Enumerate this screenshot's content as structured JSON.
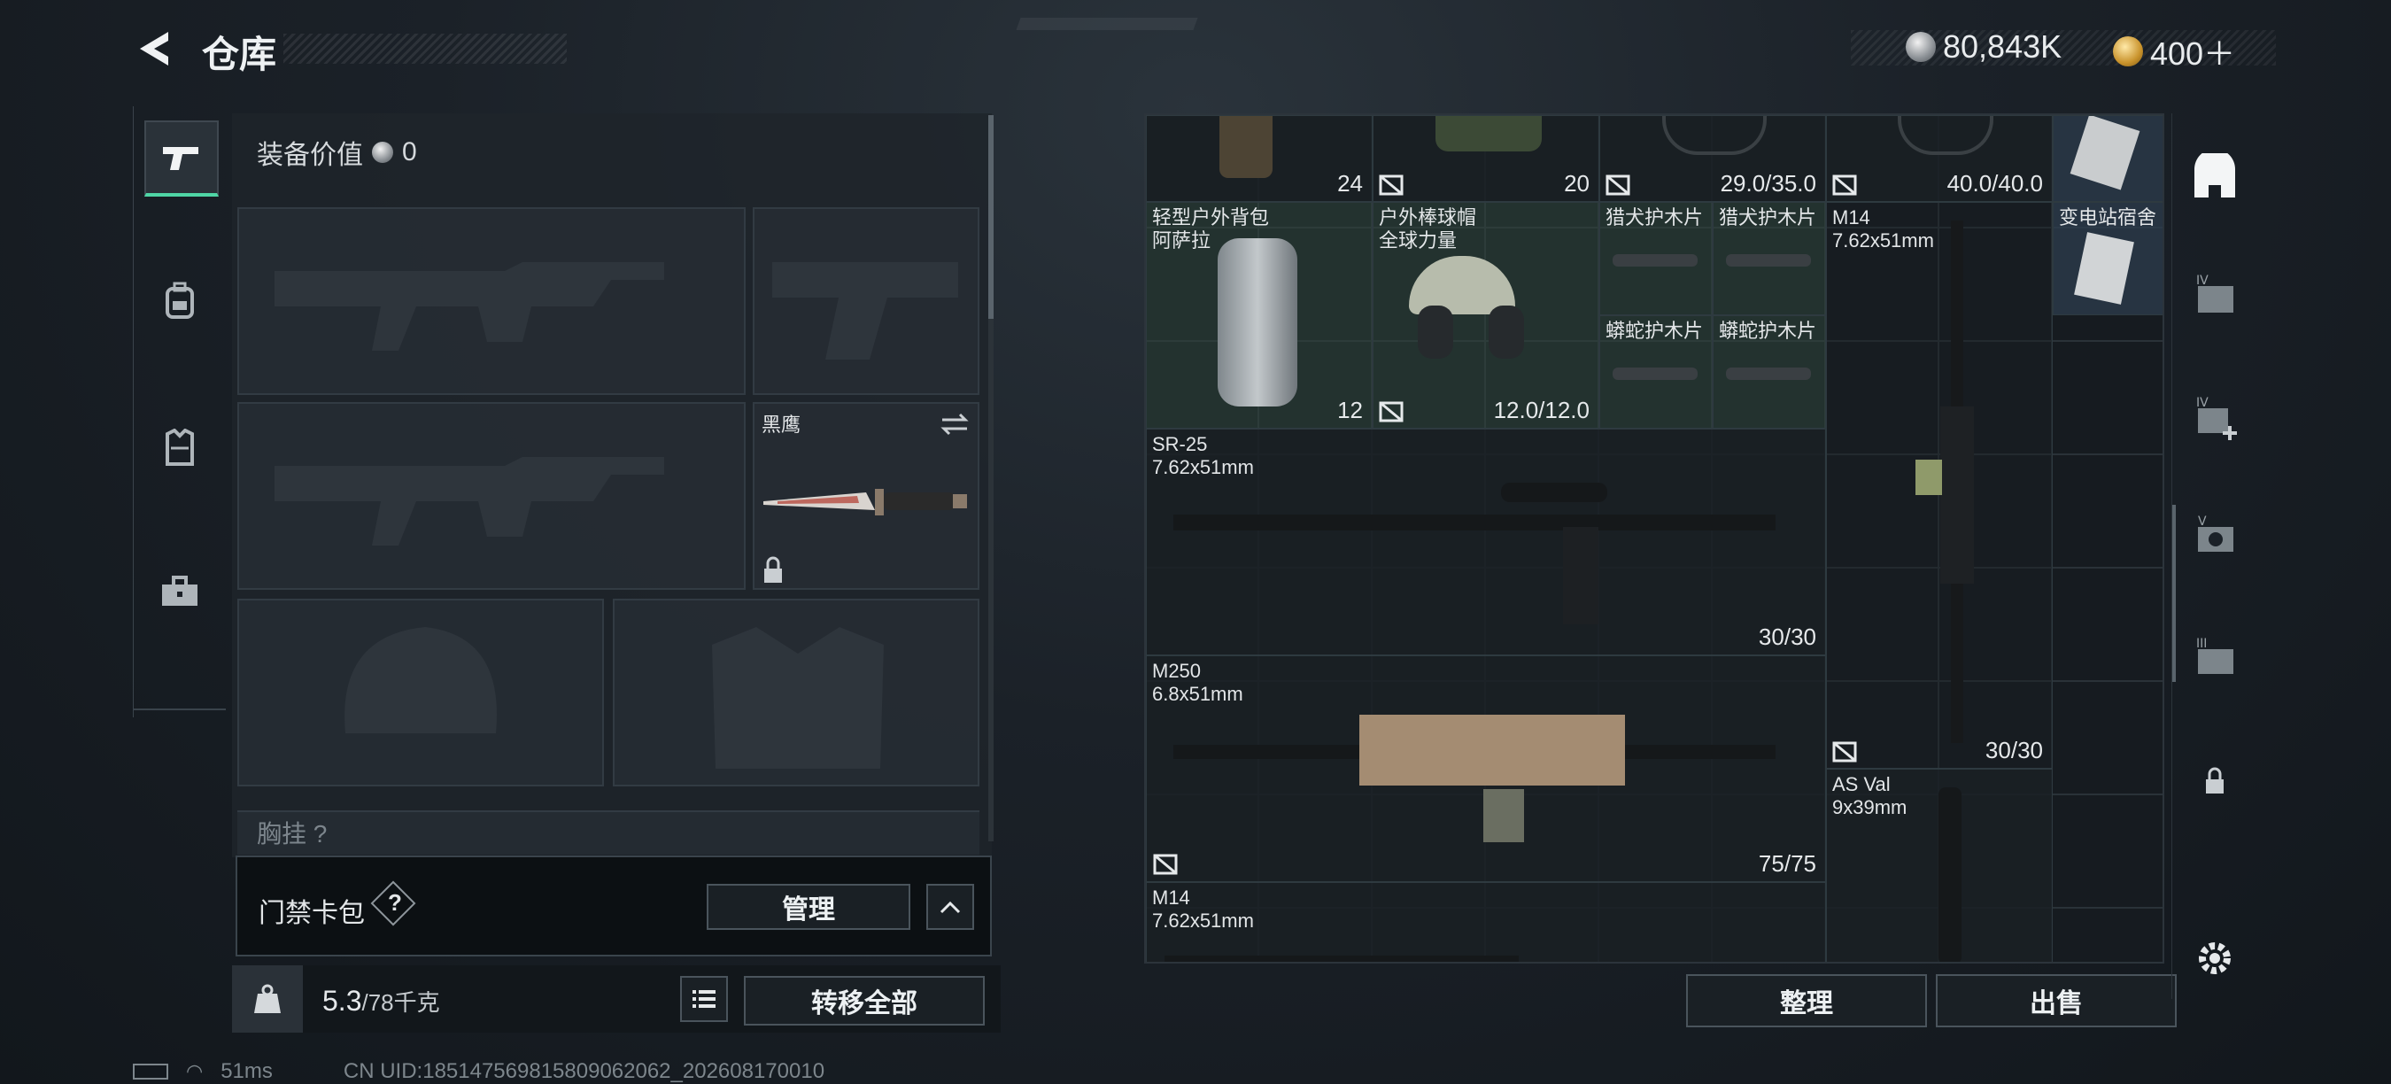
{
  "header": {
    "title": "仓库",
    "silver_amount": "80,843K",
    "gold_amount": "400＋"
  },
  "equipment": {
    "value_label": "装备价值",
    "value": "0",
    "knife_name": "黑鹰",
    "chest_rig_label": "胸挂",
    "chest_rig_count": "?"
  },
  "card_pack": {
    "label": "门禁卡包",
    "help": "?",
    "manage_label": "管理"
  },
  "weight": {
    "current": "5.3",
    "max": "/78千克",
    "transfer_all_label": "转移全部",
    "kg_icon_text": "KG"
  },
  "stash": {
    "top_counts": [
      "24",
      "20",
      "29.0/35.0",
      "40.0/40.0"
    ],
    "items": [
      {
        "name": "轻型户外背包\n阿萨拉",
        "count": "12"
      },
      {
        "name": "户外棒球帽\n全球力量",
        "count": "12.0/12.0"
      },
      {
        "name": "猎犬护木片"
      },
      {
        "name": "猎犬护木片"
      },
      {
        "name": "蟒蛇护木片"
      },
      {
        "name": "蟒蛇护木片"
      },
      {
        "name": "M14\n7.62x51mm",
        "count": "30/30"
      },
      {
        "name": "变电站宿舍"
      },
      {
        "name": "SR-25\n7.62x51mm",
        "count": "30/30"
      },
      {
        "name": "M250\n6.8x51mm",
        "count": "75/75"
      },
      {
        "name": "AS Val\n9x39mm"
      },
      {
        "name": "M14\n7.62x51mm"
      }
    ],
    "sort_label": "整理",
    "sell_label": "出售"
  },
  "status": {
    "ping": "51ms",
    "uid": "CN UID:18514756981580906206​2_202608170010"
  },
  "colors": {
    "accent_green": "#4fd6a6",
    "background": "#1b2128"
  },
  "icons": [
    "back-arrow-icon",
    "silver-coin-icon",
    "gold-coin-icon",
    "pistol-icon",
    "backpack-icon",
    "vest-icon",
    "toolbox-icon",
    "swap-icon",
    "lock-icon",
    "list-icon",
    "gear-icon"
  ]
}
